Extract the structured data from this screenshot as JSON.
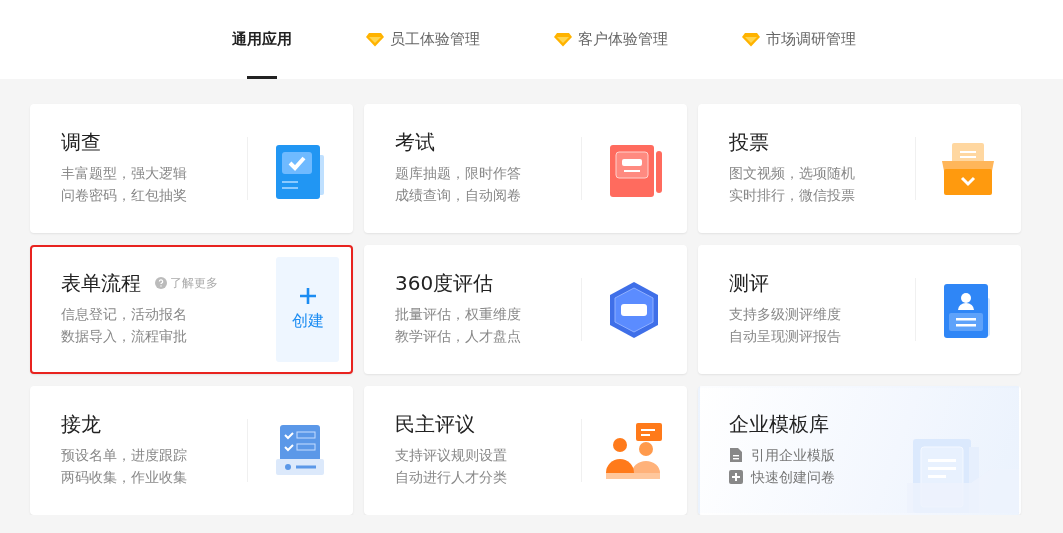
{
  "tabs": [
    {
      "label": "通用应用",
      "selected": true,
      "premium": false
    },
    {
      "label": "员工体验管理",
      "selected": false,
      "premium": true
    },
    {
      "label": "客户体验管理",
      "selected": false,
      "premium": true
    },
    {
      "label": "市场调研管理",
      "selected": false,
      "premium": true
    }
  ],
  "cards": [
    {
      "kind": "app",
      "title": "调查",
      "lines": [
        "丰富题型，强大逻辑",
        "问卷密码，红包抽奖"
      ],
      "highlighted": false
    },
    {
      "kind": "app",
      "title": "考试",
      "lines": [
        "题库抽题，限时作答",
        "成绩查询，自动阅卷"
      ],
      "highlighted": false
    },
    {
      "kind": "app",
      "title": "投票",
      "lines": [
        "图文视频，选项随机",
        "实时排行，微信投票"
      ],
      "highlighted": false
    },
    {
      "kind": "create",
      "title": "表单流程",
      "more": "了解更多",
      "lines": [
        "信息登记，活动报名",
        "数据导入，流程审批"
      ],
      "button": "创建",
      "highlighted": true
    },
    {
      "kind": "app",
      "title": "360度评估",
      "lines": [
        "批量评估，权重维度",
        "教学评估，人才盘点"
      ],
      "highlighted": false
    },
    {
      "kind": "app",
      "title": "测评",
      "lines": [
        "支持多级测评维度",
        "自动呈现测评报告"
      ],
      "highlighted": false
    },
    {
      "kind": "app",
      "title": "接龙",
      "lines": [
        "预设名单，进度跟踪",
        "两码收集，作业收集"
      ],
      "highlighted": false
    },
    {
      "kind": "app",
      "title": "民主评议",
      "lines": [
        "支持评议规则设置",
        "自动进行人才分类"
      ],
      "highlighted": false
    },
    {
      "kind": "templates",
      "title": "企业模板库",
      "links": [
        "引用企业模版",
        "快速创建问卷"
      ],
      "highlighted": false
    }
  ]
}
